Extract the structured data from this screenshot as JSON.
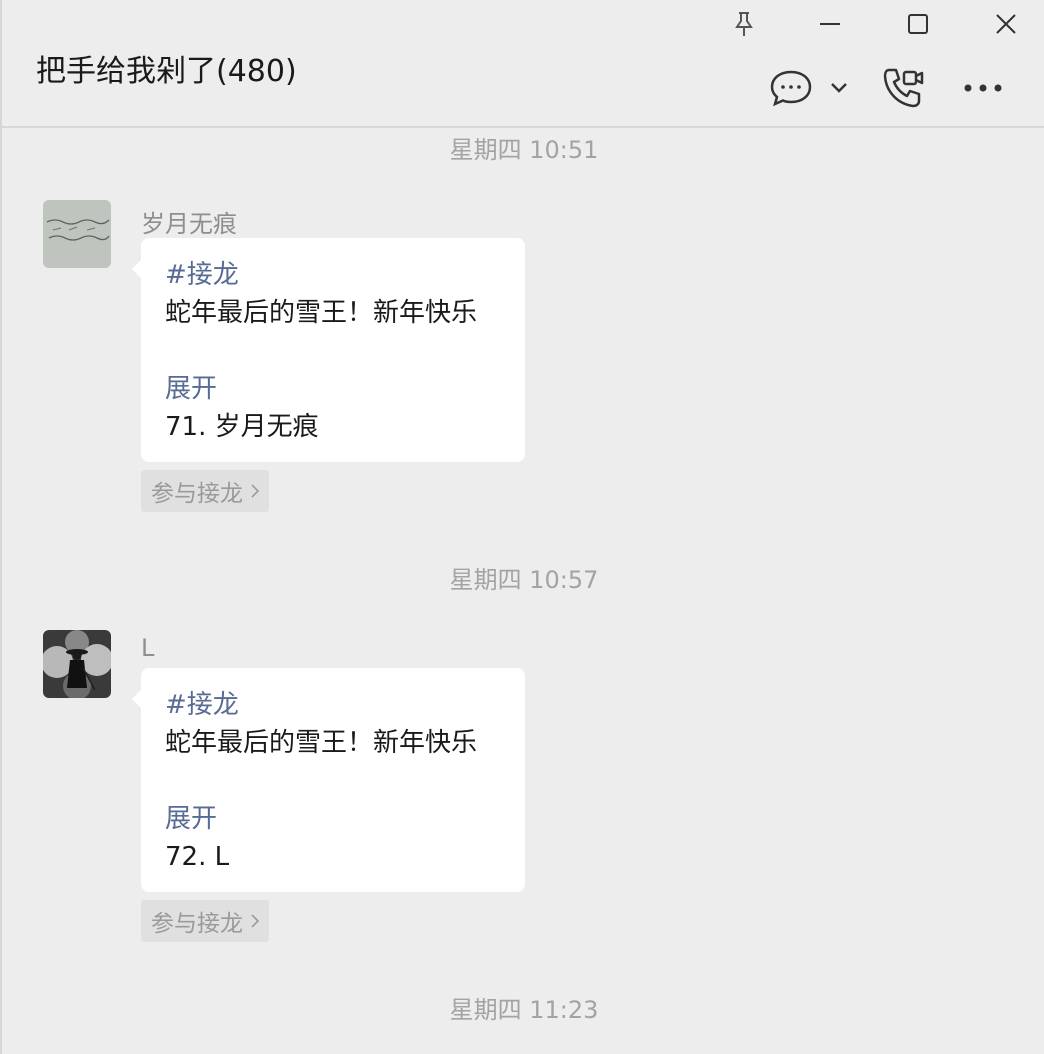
{
  "window": {
    "title": "把手给我剁了(480)"
  },
  "messages": [
    {
      "timestamp": "星期四 10:51",
      "sender": "岁月无痕",
      "hashtag": "#接龙",
      "text": "蛇年最后的雪王！新年快乐",
      "expand": "展开",
      "entry": "71. 岁月无痕",
      "join_label": "参与接龙"
    },
    {
      "timestamp": "星期四 10:57",
      "sender": "L",
      "hashtag": "#接龙",
      "text": "蛇年最后的雪王！新年快乐",
      "expand": "展开",
      "entry": "72. L",
      "join_label": "参与接龙"
    }
  ],
  "last_timestamp": "星期四 11:23",
  "icons": {
    "pin": "pin-icon",
    "minimize": "minimize-icon",
    "maximize": "maximize-icon",
    "close": "close-icon",
    "chat": "chat-bubble-icon",
    "dropdown": "chevron-down-icon",
    "call": "phone-video-icon",
    "more": "more-icon"
  }
}
